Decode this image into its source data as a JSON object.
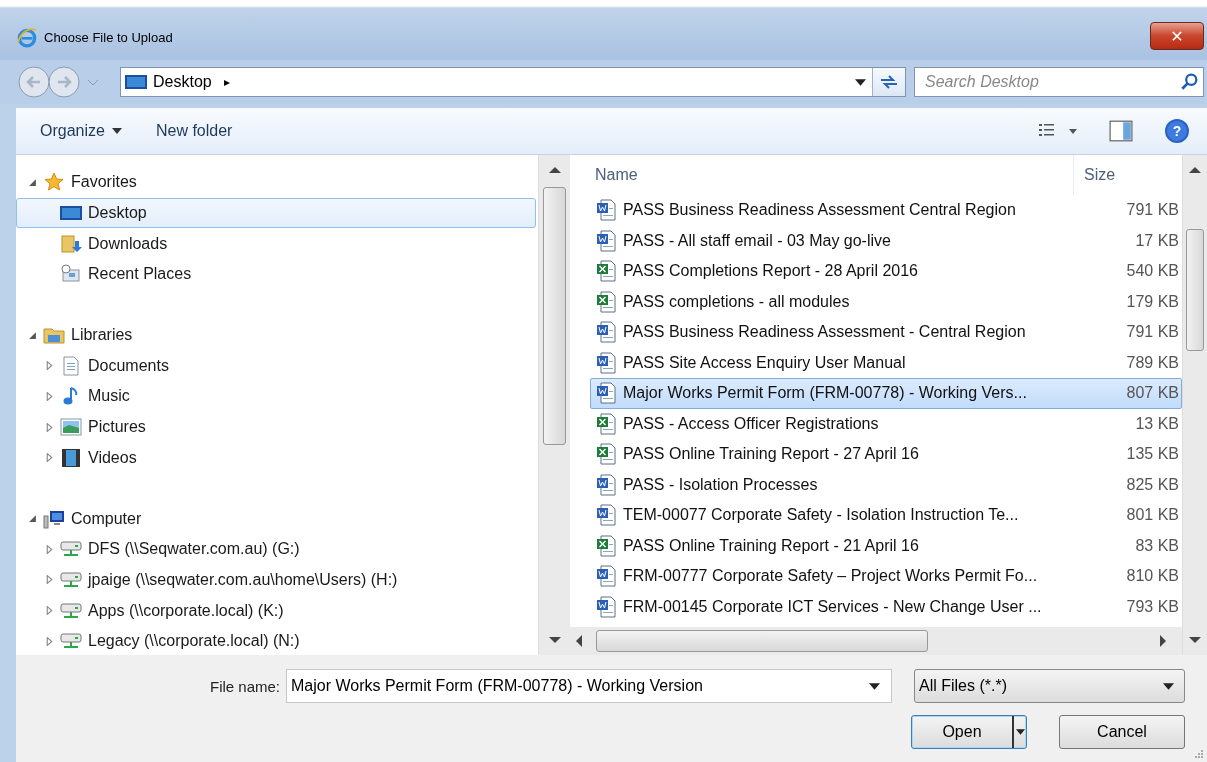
{
  "window": {
    "title": "Choose File to Upload",
    "close": "✕"
  },
  "address_bar": {
    "location": "Desktop",
    "separator": "▸"
  },
  "search": {
    "placeholder": "Search Desktop"
  },
  "toolbar": {
    "items": [
      {
        "label": "Organize",
        "menu": true
      },
      {
        "label": "New folder",
        "menu": false
      }
    ],
    "help": "?"
  },
  "sidebar": {
    "groups": [
      {
        "label": "Favorites",
        "expanded": true,
        "children": [
          {
            "label": "Desktop",
            "selected": true
          },
          {
            "label": "Downloads",
            "selected": false
          },
          {
            "label": "Recent Places",
            "selected": false
          }
        ]
      },
      {
        "label": "Libraries",
        "expanded": true,
        "children": [
          {
            "label": "Documents",
            "selected": false,
            "expanded": false
          },
          {
            "label": "Music",
            "selected": false,
            "expanded": false
          },
          {
            "label": "Pictures",
            "selected": false,
            "expanded": false
          },
          {
            "label": "Videos",
            "selected": false,
            "expanded": false
          }
        ]
      },
      {
        "label": "Computer",
        "expanded": true,
        "children": [
          {
            "label": "DFS (\\\\Seqwater.com.au) (G:)",
            "selected": false,
            "expanded": false
          },
          {
            "label": "jpaige (\\\\seqwater.com.au\\home\\Users) (H:)",
            "selected": false,
            "expanded": false
          },
          {
            "label": "Apps (\\\\corporate.local) (K:)",
            "selected": false,
            "expanded": false
          },
          {
            "label": "Legacy (\\\\corporate.local) (N:)",
            "selected": false,
            "expanded": false
          }
        ]
      }
    ]
  },
  "file_list": {
    "columns": [
      "Name",
      "Size"
    ],
    "rows": [
      {
        "name": "PASS Business Readiness Assessment Central Region",
        "size": "791 KB",
        "kind": "word",
        "selected": false
      },
      {
        "name": "PASS - All staff email - 03 May go-live",
        "size": "17 KB",
        "kind": "word",
        "selected": false
      },
      {
        "name": "PASS Completions Report - 28 April 2016",
        "size": "540 KB",
        "kind": "excel",
        "selected": false
      },
      {
        "name": "PASS completions - all modules",
        "size": "179 KB",
        "kind": "excel",
        "selected": false
      },
      {
        "name": "PASS Business Readiness Assessment - Central Region",
        "size": "791 KB",
        "kind": "word",
        "selected": false
      },
      {
        "name": "PASS Site Access Enquiry User Manual",
        "size": "789 KB",
        "kind": "word",
        "selected": false
      },
      {
        "name": "Major Works Permit Form (FRM-00778) - Working Vers...",
        "size": "807 KB",
        "kind": "word",
        "selected": true
      },
      {
        "name": "PASS - Access Officer Registrations",
        "size": "13 KB",
        "kind": "excel",
        "selected": false
      },
      {
        "name": "PASS Online Training Report - 27 April 16",
        "size": "135 KB",
        "kind": "excel",
        "selected": false
      },
      {
        "name": "PASS - Isolation Processes",
        "size": "825 KB",
        "kind": "word",
        "selected": false
      },
      {
        "name": "TEM-00077 Corporate Safety - Isolation Instruction Te...",
        "size": "801 KB",
        "kind": "word",
        "selected": false
      },
      {
        "name": "PASS Online Training Report - 21 April 16",
        "size": "83 KB",
        "kind": "excel",
        "selected": false
      },
      {
        "name": "FRM-00777 Corporate Safety – Project Works Permit Fo...",
        "size": "810 KB",
        "kind": "word",
        "selected": false
      },
      {
        "name": "FRM-00145 Corporate ICT Services - New Change User ...",
        "size": "793 KB",
        "kind": "word",
        "selected": false
      }
    ]
  },
  "footer": {
    "file_name_label": "File name:",
    "file_name": "Major Works Permit Form (FRM-00778) - Working Version",
    "file_type": "All Files (*.*)",
    "buttons": [
      {
        "label": "Open",
        "kind": "split"
      },
      {
        "label": "Cancel",
        "kind": "plain"
      }
    ]
  }
}
